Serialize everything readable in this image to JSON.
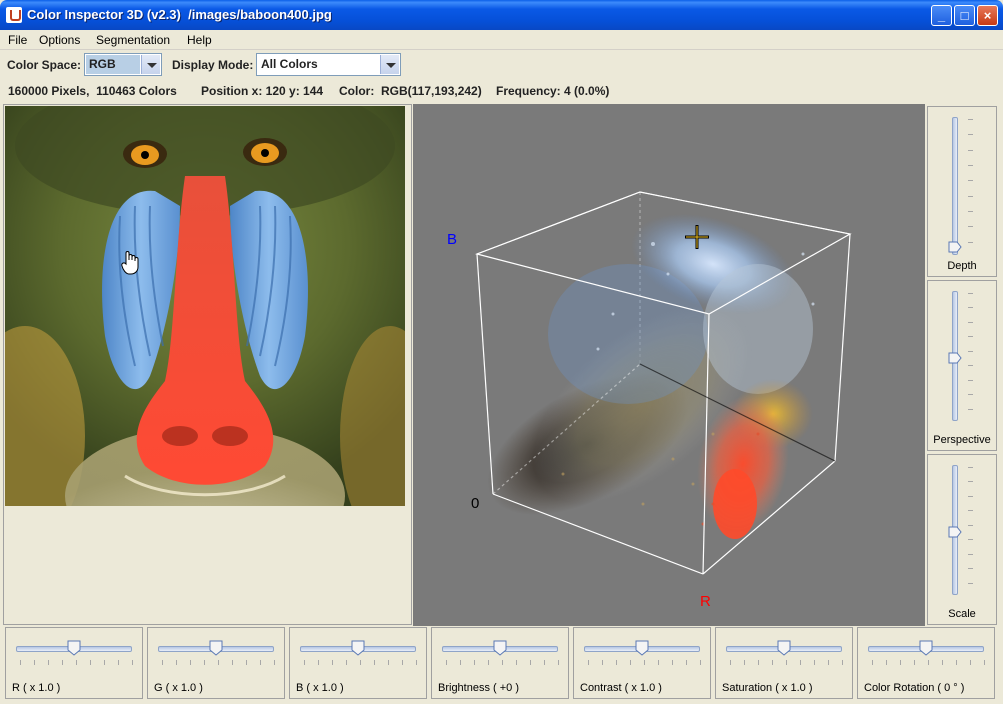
{
  "window": {
    "title": "Color Inspector 3D (v2.3)  /images/baboon400.jpg",
    "minimize_label": "_",
    "maximize_label": "□",
    "close_label": "×"
  },
  "menu": [
    "File",
    "Options",
    "Segmentation",
    "Help"
  ],
  "toolbar": {
    "color_space_label": "Color Space:",
    "color_space_value": "RGB",
    "display_mode_label": "Display Mode:",
    "display_mode_value": "All Colors"
  },
  "info": {
    "pixels": "160000 Pixels,  110463 Colors",
    "position": "Position x: 120 y: 144",
    "color": "Color:  RGB(117,193,242)",
    "frequency": "Frequency: 4 (0.0%)"
  },
  "view3d": {
    "axis_b": "B",
    "axis_r": "R",
    "origin": "0",
    "axis_b_color": "#0000FF",
    "axis_r_color": "#FF0000",
    "background": "#7A7A7A"
  },
  "right_sliders": [
    {
      "label": "Depth",
      "level": 0.0
    },
    {
      "label": "Perspective",
      "level": 0.5
    },
    {
      "label": "Scale",
      "level": 0.5
    }
  ],
  "bottom_sliders": [
    {
      "label": "R ( x 1.0 )",
      "level": 0.5
    },
    {
      "label": "G ( x 1.0 )",
      "level": 0.5
    },
    {
      "label": "B ( x 1.0 )",
      "level": 0.5
    },
    {
      "label": "Brightness ( +0 )",
      "level": 0.5
    },
    {
      "label": "Contrast ( x 1.0 )",
      "level": 0.5
    },
    {
      "label": "Saturation ( x 1.0 )",
      "level": 0.5
    },
    {
      "label": "Color Rotation ( 0 ° )",
      "level": 0.5
    }
  ],
  "colors": {
    "titlebar": "#0A59E6",
    "window_bg": "#ECE9D8",
    "nose_red": "#F0402C",
    "cheek_blue": "#6FA8E0"
  },
  "icons": [
    "app-icon",
    "hand-cursor-icon",
    "crosshair-icon",
    "dropdown-arrow-icon"
  ]
}
